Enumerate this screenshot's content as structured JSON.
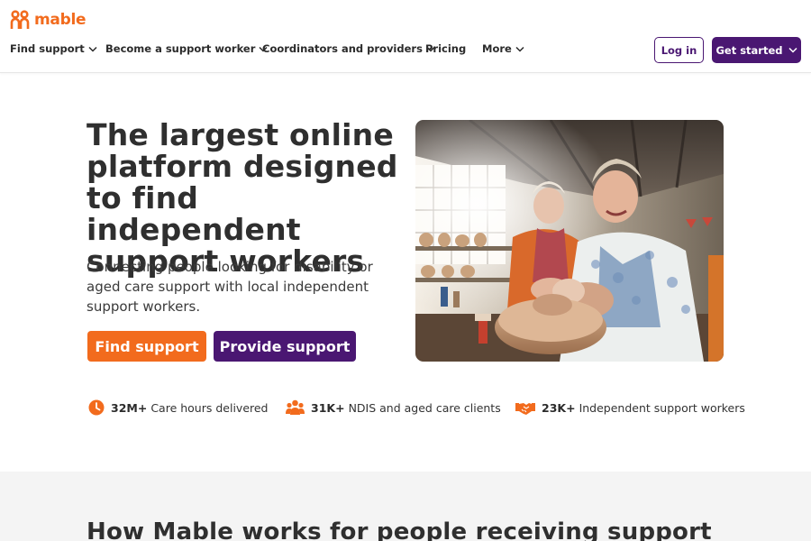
{
  "brand": {
    "name": "mable",
    "accent_orange": "#f26b1d",
    "accent_purple": "#4a1772"
  },
  "nav": {
    "items": [
      {
        "label": "Find support",
        "has_dropdown": true
      },
      {
        "label": "Become a support worker",
        "has_dropdown": true
      },
      {
        "label": "Coordinators and providers",
        "has_dropdown": true
      },
      {
        "label": "Pricing",
        "has_dropdown": false
      },
      {
        "label": "More",
        "has_dropdown": true
      }
    ],
    "login_label": "Log in",
    "get_started_label": "Get started"
  },
  "hero": {
    "title": "The largest online platform designed to find independent support workers",
    "subtitle": "Connecting people looking for disability or aged care support with local independent support workers.",
    "find_support_label": "Find support",
    "provide_support_label": "Provide support"
  },
  "stats": [
    {
      "icon": "clock-icon",
      "value": "32M+",
      "label": "Care hours delivered"
    },
    {
      "icon": "people-group-icon",
      "value": "31K+",
      "label": "NDIS and aged care clients"
    },
    {
      "icon": "handshake-icon",
      "value": "23K+",
      "label": "Independent support workers"
    }
  ],
  "section": {
    "title": "How Mable works for people receiving support"
  }
}
